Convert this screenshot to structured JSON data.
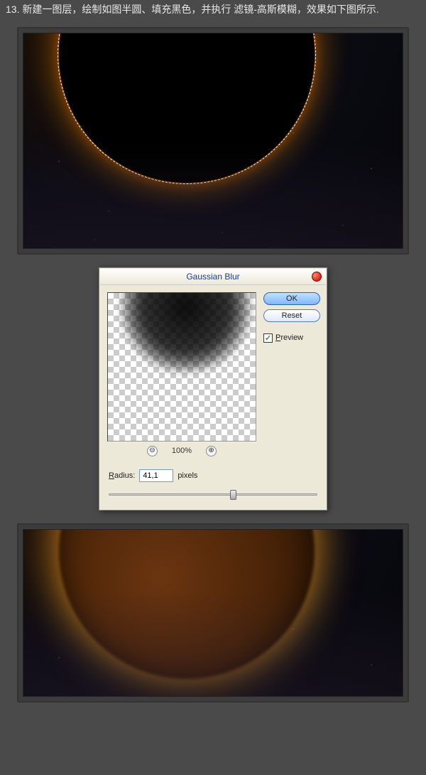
{
  "step_number": "13.",
  "instruction_text": "新建一图层，绘制如图半圆、填充黑色，并执行 滤镜-高斯模糊，效果如下图所示.",
  "dialog": {
    "title": "Gaussian Blur",
    "ok_label": "OK",
    "reset_label": "Reset",
    "preview_label": "review",
    "preview_prefix": "P",
    "zoom_level": "100%",
    "zoom_out": "⊖",
    "zoom_in": "⊕",
    "radius_label_prefix": "R",
    "radius_label_rest": "adius:",
    "radius_value": "41,1",
    "radius_unit": "pixels",
    "checkmark": "✓"
  }
}
